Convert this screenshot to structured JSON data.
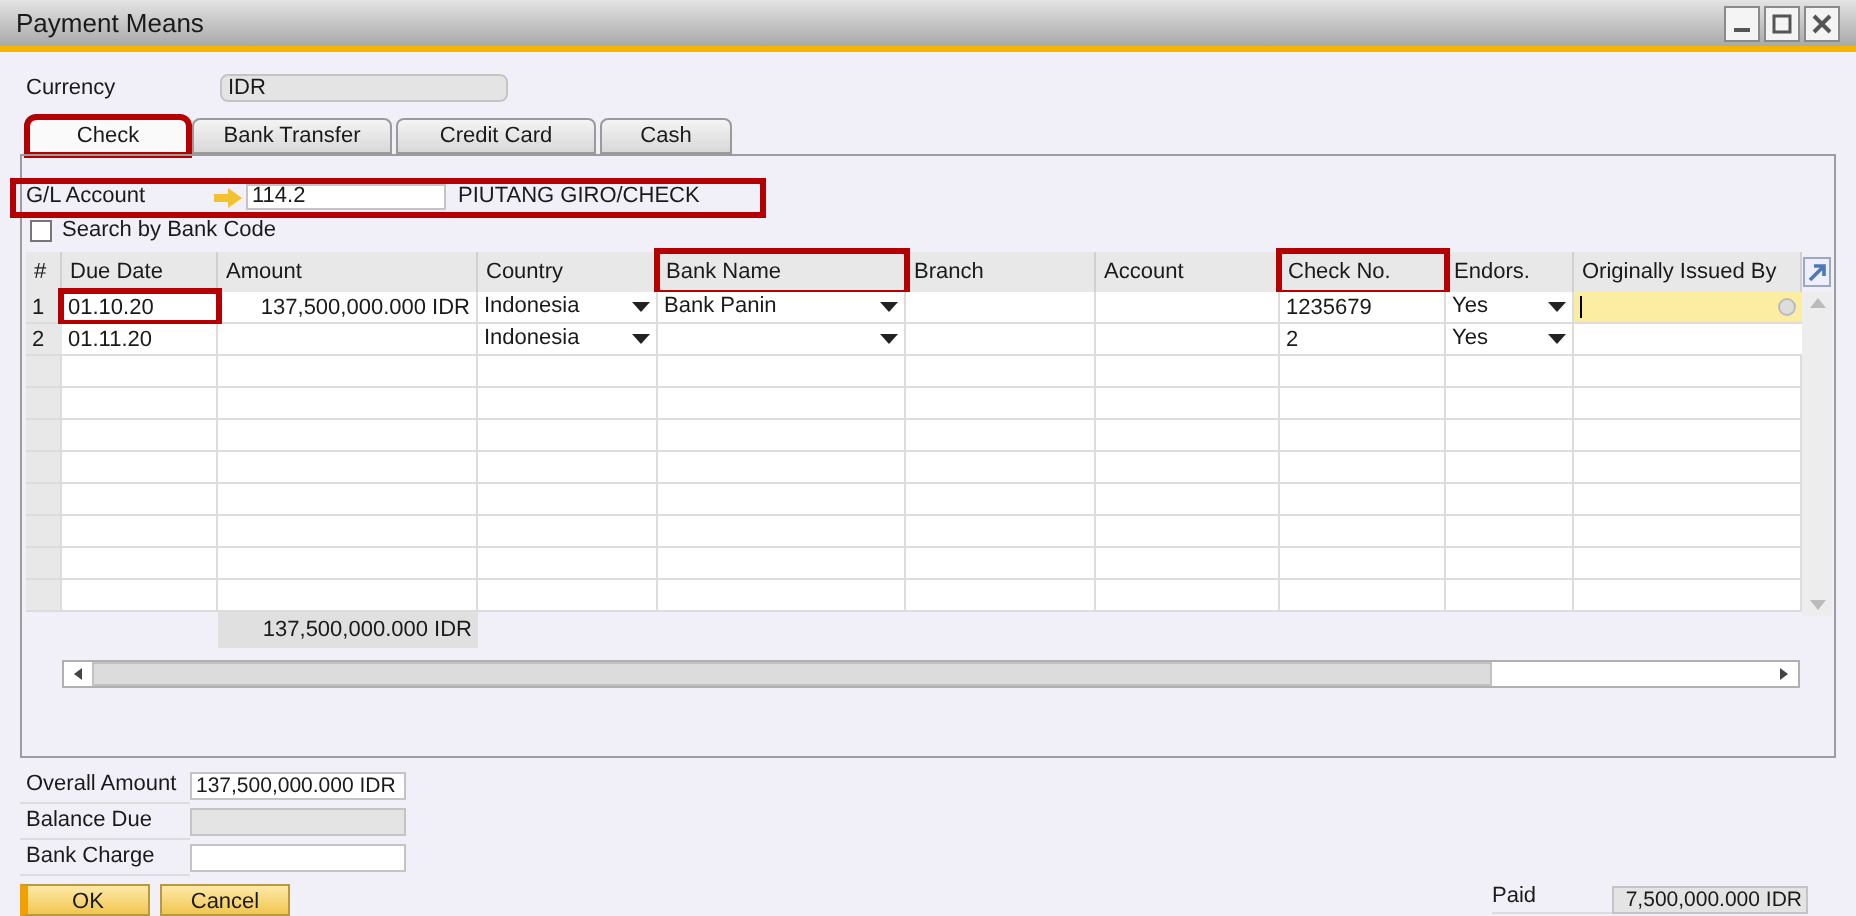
{
  "window": {
    "title": "Payment Means"
  },
  "currency": {
    "label": "Currency",
    "value": "IDR"
  },
  "tabs": [
    {
      "label": "Check",
      "selected": true,
      "highlighted": true
    },
    {
      "label": "Bank Transfer",
      "selected": false,
      "highlighted": false
    },
    {
      "label": "Credit Card",
      "selected": false,
      "highlighted": false
    },
    {
      "label": "Cash",
      "selected": false,
      "highlighted": false
    }
  ],
  "gl_account": {
    "label": "G/L Account",
    "value": "114.2",
    "name": "PIUTANG GIRO/CHECK",
    "highlighted": true
  },
  "search_by_bank_code": {
    "label": "Search by Bank Code",
    "checked": false
  },
  "table": {
    "columns": [
      {
        "label": "#",
        "highlighted": false
      },
      {
        "label": "Due Date",
        "highlighted": false
      },
      {
        "label": "Amount",
        "highlighted": false
      },
      {
        "label": "Country",
        "highlighted": false
      },
      {
        "label": "Bank Name",
        "highlighted": true
      },
      {
        "label": "Branch",
        "highlighted": false
      },
      {
        "label": "Account",
        "highlighted": false
      },
      {
        "label": "Check No.",
        "highlighted": true
      },
      {
        "label": "Endors.",
        "highlighted": false
      },
      {
        "label": "Originally Issued By",
        "highlighted": false
      }
    ],
    "rows": [
      {
        "num": "1",
        "due_date": "01.10.20",
        "due_date_highlighted": true,
        "amount": "137,500,000.000 IDR",
        "country": "Indonesia",
        "bank_name": "Bank Panin",
        "branch": "",
        "account": "",
        "check_no": "1235679",
        "endors": "Yes",
        "issued_by_active": true
      },
      {
        "num": "2",
        "due_date": "01.11.20",
        "due_date_highlighted": false,
        "amount": "",
        "country": "Indonesia",
        "bank_name": "",
        "branch": "",
        "account": "",
        "check_no": "2",
        "endors": "Yes",
        "issued_by_active": false
      }
    ],
    "total": "137,500,000.000 IDR"
  },
  "overall_amount": {
    "label": "Overall Amount",
    "value": "137,500,000.000 IDR"
  },
  "balance_due": {
    "label": "Balance Due"
  },
  "bank_charge": {
    "label": "Bank Charge"
  },
  "paid": {
    "label": "Paid",
    "value": "7,500,000.000 IDR"
  },
  "buttons": [
    {
      "label": "OK"
    },
    {
      "label": "Cancel"
    }
  ]
}
